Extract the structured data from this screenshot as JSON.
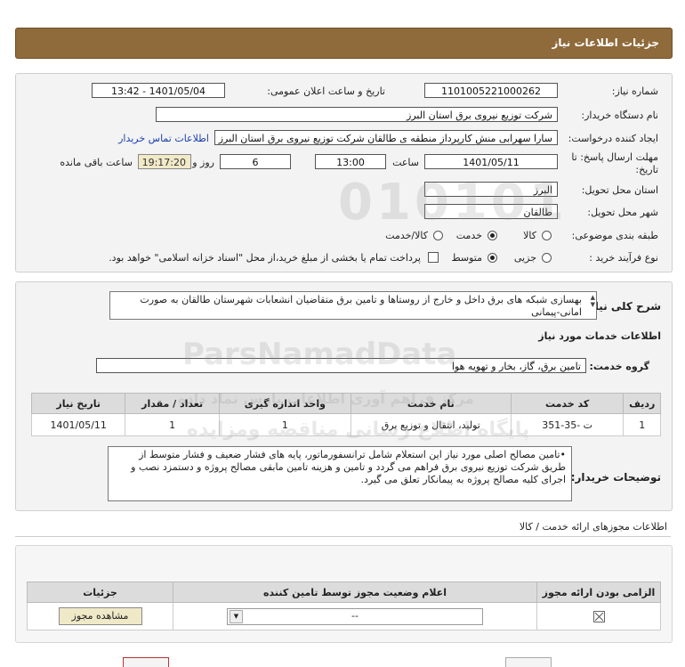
{
  "header": {
    "title": "جزئیات اطلاعات نیاز"
  },
  "form": {
    "need_number_label": "شماره نیاز:",
    "need_number": "1101005221000262",
    "announce_label": "تاریخ و ساعت اعلان عمومی:",
    "announce_value": "1401/05/04 - 13:42",
    "buyer_org_label": "نام دستگاه خریدار:",
    "buyer_org": "شرکت توزیع نیروی برق استان البرز",
    "creator_label": "ایجاد کننده درخواست:",
    "creator": "سارا سهرابی منش کارپرداز منطقه ی طالقان شرکت توزیع نیروی برق استان البرز",
    "contact_link": "اطلاعات تماس خریدار",
    "deadline_label_1": "مهلت ارسال پاسخ: تا",
    "deadline_label_2": "تاریخ:",
    "deadline_date": "1401/05/11",
    "time_label": "ساعت",
    "deadline_time": "13:00",
    "days_value": "6",
    "days_label": "روز و",
    "remaining_time": "19:17:20",
    "remaining_label": "ساعت باقی مانده",
    "province_label": "استان محل تحویل:",
    "province": "البرز",
    "city_label": "شهر محل تحویل:",
    "city": "طالقان",
    "category_label": "طبقه بندی موضوعی:",
    "category_options": [
      "کالا",
      "خدمت",
      "کالا/خدمت"
    ],
    "category_selected": "خدمت",
    "process_label": "نوع فرآیند خرید :",
    "process_options": [
      "جزیی",
      "متوسط"
    ],
    "process_selected": "متوسط",
    "payment_note": "پرداخت تمام یا بخشی از مبلغ خرید،از محل \"اسناد خزانه اسلامی\" خواهد بود."
  },
  "need": {
    "summary_label": "شرح کلی نیاز:",
    "summary": "بهسازی شبکه های برق داخل و خارج از روستاها و تامین برق متقاضیان انشعابات شهرستان طالقان به صورت امانی-پیمانی",
    "services_title": "اطلاعات خدمات مورد نیاز",
    "service_group_label": "گروه خدمت:",
    "service_group": "تامین برق، گاز، بخار و تهویه هوا",
    "table": {
      "headers": [
        "ردیف",
        "کد خدمت",
        "نام خدمت",
        "واحد اندازه گیری",
        "تعداد / مقدار",
        "تاریخ نیاز"
      ],
      "rows": [
        [
          "1",
          "ت -35-351",
          "تولید، انتقال و توزیع برق",
          "1",
          "1",
          "1401/05/11"
        ]
      ]
    },
    "buyer_notes_label": "توضیحات خریدار:",
    "buyer_notes": "•تامین مصالح اصلی  مورد نیاز این استعلام شامل ترانسفورماتور، پایه های فشار ضعیف و فشار متوسط از طریق شرکت توزیع نیروی برق فراهم می گردد و تامین و هزینه تامین مابقی مصالح پروژه و دستمزد نصب و اجرای کلیه مصالح پروژه به پیمانکار تعلق می گیرد."
  },
  "permits": {
    "title": "اطلاعات مجوزهای ارائه خدمت / کالا",
    "headers": [
      "الزامی بودن ارائه مجوز",
      "اعلام وضعیت مجوز توسط تامین کننده",
      "جزئیات"
    ],
    "select_value": "--",
    "view_button": "مشاهده مجوز"
  },
  "watermark": {
    "digits": "010101",
    "brand": "ParsNamadData",
    "line1": "مرکز فراهم آوری اطلاعات پارس نماد داده",
    "line2": "پایگاه اطلاع رسانی مناقصه ومزایده"
  }
}
